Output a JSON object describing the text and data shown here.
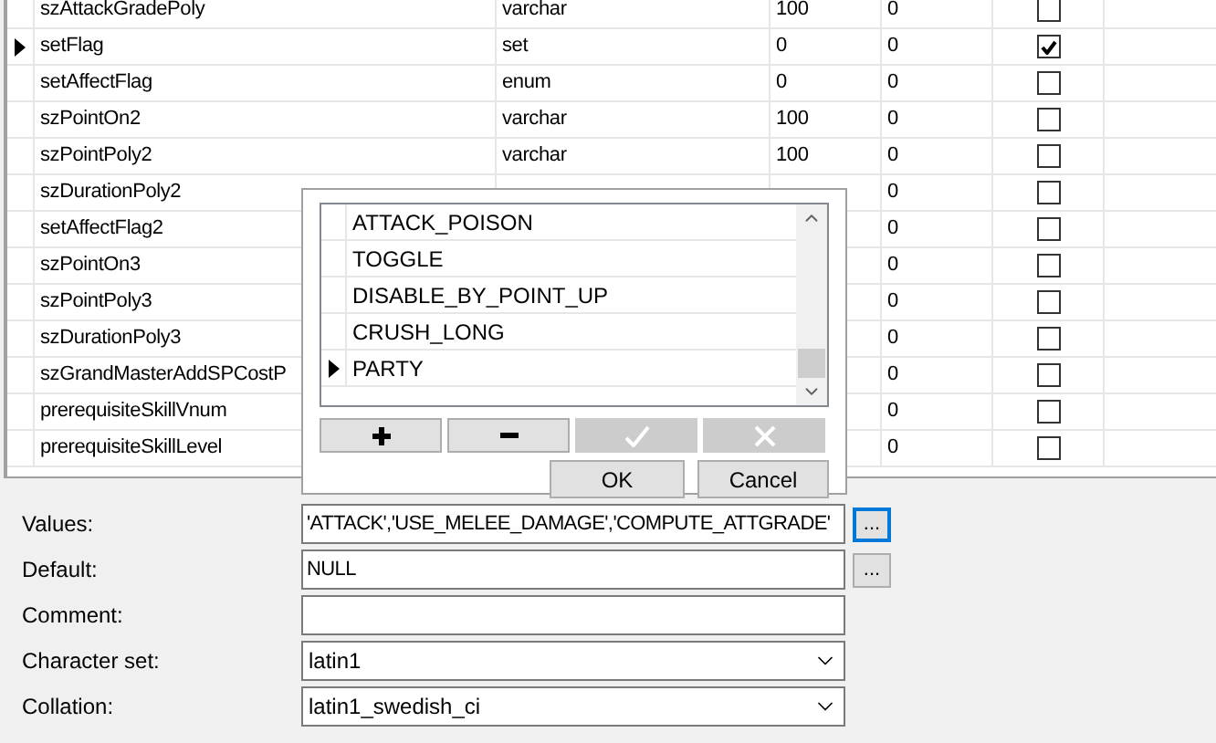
{
  "table": {
    "rows": [
      {
        "name": "szAttackGradePoly",
        "type": "varchar",
        "length": "100",
        "decimals": "0",
        "checked": false,
        "current": false
      },
      {
        "name": "setFlag",
        "type": "set",
        "length": "0",
        "decimals": "0",
        "checked": true,
        "current": true
      },
      {
        "name": "setAffectFlag",
        "type": "enum",
        "length": "0",
        "decimals": "0",
        "checked": false,
        "current": false
      },
      {
        "name": "szPointOn2",
        "type": "varchar",
        "length": "100",
        "decimals": "0",
        "checked": false,
        "current": false
      },
      {
        "name": "szPointPoly2",
        "type": "varchar",
        "length": "100",
        "decimals": "0",
        "checked": false,
        "current": false
      },
      {
        "name": "szDurationPoly2",
        "decimals": "0",
        "checked": false,
        "current": false
      },
      {
        "name": "setAffectFlag2",
        "decimals": "0",
        "checked": false,
        "current": false
      },
      {
        "name": "szPointOn3",
        "decimals": "0",
        "checked": false,
        "current": false
      },
      {
        "name": "szPointPoly3",
        "decimals": "0",
        "checked": false,
        "current": false
      },
      {
        "name": "szDurationPoly3",
        "decimals": "0",
        "checked": false,
        "current": false
      },
      {
        "name": "szGrandMasterAddSPCostP",
        "decimals": "0",
        "checked": false,
        "current": false
      },
      {
        "name": "prerequisiteSkillVnum",
        "decimals": "0",
        "checked": false,
        "current": false
      },
      {
        "name": "prerequisiteSkillLevel",
        "decimals": "0",
        "checked": false,
        "current": false
      }
    ]
  },
  "popup": {
    "items": [
      {
        "label": "ATTACK_POISON",
        "current": false
      },
      {
        "label": "TOGGLE",
        "current": false
      },
      {
        "label": "DISABLE_BY_POINT_UP",
        "current": false
      },
      {
        "label": "CRUSH_LONG",
        "current": false
      },
      {
        "label": "PARTY",
        "current": true
      }
    ],
    "tools": [
      {
        "kind": "add",
        "disabled": false
      },
      {
        "kind": "remove",
        "disabled": false
      },
      {
        "kind": "apply",
        "disabled": true
      },
      {
        "kind": "cancel",
        "disabled": true
      }
    ],
    "ok": "OK",
    "cancel": "Cancel"
  },
  "form": [
    {
      "label": "Values:",
      "value": "'ATTACK','USE_MELEE_DAMAGE','COMPUTE_ATTGRADE'",
      "kind": "text",
      "browse": "...",
      "focused": true
    },
    {
      "label": "Default:",
      "value": "NULL",
      "kind": "text",
      "browse": "...",
      "focused": false
    },
    {
      "label": "Comment:",
      "kind": "text"
    },
    {
      "label": "Character set:",
      "value": "latin1",
      "kind": "select"
    },
    {
      "label": "Collation:",
      "value": "latin1_swedish_ci",
      "kind": "select"
    }
  ]
}
